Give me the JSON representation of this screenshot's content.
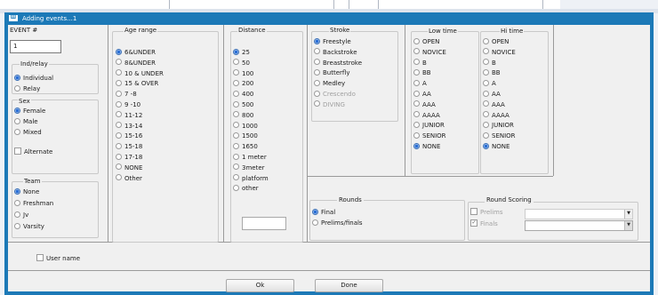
{
  "window": {
    "title": "Adding events...1",
    "icon": "app-icon"
  },
  "event": {
    "label": "EVENT #",
    "value": "1"
  },
  "indrelay": {
    "title": "Ind/relay",
    "options": [
      {
        "label": "Individual",
        "selected": true
      },
      {
        "label": "Relay",
        "selected": false
      }
    ]
  },
  "sex": {
    "title": "Sex",
    "options": [
      {
        "label": "Female",
        "selected": true
      },
      {
        "label": "Male",
        "selected": false
      },
      {
        "label": "Mixed",
        "selected": false
      }
    ],
    "alternate_label": "Alternate",
    "alternate_checked": false
  },
  "team": {
    "title": "Team",
    "options": [
      {
        "label": "None",
        "selected": true
      },
      {
        "label": "Freshman",
        "selected": false
      },
      {
        "label": "Jv",
        "selected": false
      },
      {
        "label": "Varsity",
        "selected": false
      }
    ]
  },
  "age": {
    "title": "Age range",
    "options": [
      {
        "label": "6&UNDER",
        "selected": true
      },
      {
        "label": "8&UNDER",
        "selected": false
      },
      {
        "label": "10 & UNDER",
        "selected": false
      },
      {
        "label": "15 & OVER",
        "selected": false
      },
      {
        "label": "7 -8",
        "selected": false
      },
      {
        "label": "9 -10",
        "selected": false
      },
      {
        "label": "11-12",
        "selected": false
      },
      {
        "label": "13-14",
        "selected": false
      },
      {
        "label": "15-16",
        "selected": false
      },
      {
        "label": "15-18",
        "selected": false
      },
      {
        "label": "17-18",
        "selected": false
      },
      {
        "label": "NONE",
        "selected": false
      },
      {
        "label": "Other",
        "selected": false
      }
    ]
  },
  "distance": {
    "title": "Distance",
    "other_value": "",
    "options": [
      {
        "label": "25",
        "selected": true
      },
      {
        "label": "50",
        "selected": false
      },
      {
        "label": "100",
        "selected": false
      },
      {
        "label": "200",
        "selected": false
      },
      {
        "label": "400",
        "selected": false
      },
      {
        "label": "500",
        "selected": false
      },
      {
        "label": "800",
        "selected": false
      },
      {
        "label": "1000",
        "selected": false
      },
      {
        "label": "1500",
        "selected": false
      },
      {
        "label": "1650",
        "selected": false
      },
      {
        "label": "1 meter",
        "selected": false
      },
      {
        "label": "3meter",
        "selected": false
      },
      {
        "label": "platform",
        "selected": false
      },
      {
        "label": "other",
        "selected": false
      }
    ]
  },
  "stroke": {
    "title": "Stroke",
    "options": [
      {
        "label": "Freestyle",
        "selected": true,
        "disabled": false
      },
      {
        "label": "Backstroke",
        "selected": false,
        "disabled": false
      },
      {
        "label": "Breaststroke",
        "selected": false,
        "disabled": false
      },
      {
        "label": "Butterfly",
        "selected": false,
        "disabled": false
      },
      {
        "label": "Medley",
        "selected": false,
        "disabled": false
      },
      {
        "label": "Crescendo",
        "selected": false,
        "disabled": true
      },
      {
        "label": "DIVING",
        "selected": false,
        "disabled": true
      }
    ]
  },
  "lowtime": {
    "title": "Low time",
    "options": [
      {
        "label": "OPEN",
        "selected": false
      },
      {
        "label": "NOVICE",
        "selected": false
      },
      {
        "label": "B",
        "selected": false
      },
      {
        "label": "BB",
        "selected": false
      },
      {
        "label": "A",
        "selected": false
      },
      {
        "label": "AA",
        "selected": false
      },
      {
        "label": "AAA",
        "selected": false
      },
      {
        "label": "AAAA",
        "selected": false
      },
      {
        "label": "JUNIOR",
        "selected": false
      },
      {
        "label": "SENIOR",
        "selected": false
      },
      {
        "label": "NONE",
        "selected": true
      }
    ]
  },
  "hitime": {
    "title": "Hi time",
    "options": [
      {
        "label": "OPEN",
        "selected": false
      },
      {
        "label": "NOVICE",
        "selected": false
      },
      {
        "label": "B",
        "selected": false
      },
      {
        "label": "BB",
        "selected": false
      },
      {
        "label": "A",
        "selected": false
      },
      {
        "label": "AA",
        "selected": false
      },
      {
        "label": "AAA",
        "selected": false
      },
      {
        "label": "AAAA",
        "selected": false
      },
      {
        "label": "JUNIOR",
        "selected": false
      },
      {
        "label": "SENIOR",
        "selected": false
      },
      {
        "label": "NONE",
        "selected": true
      }
    ]
  },
  "rounds": {
    "title": "Rounds",
    "options": [
      {
        "label": "Final",
        "selected": true
      },
      {
        "label": "Prelims/finals",
        "selected": false
      }
    ]
  },
  "round_scoring": {
    "title": "Round Scoring",
    "prelims": {
      "label": "Prelims",
      "checked": false,
      "disabled": true,
      "value": ""
    },
    "finals": {
      "label": "Finals",
      "checked": true,
      "disabled": true,
      "value": ""
    }
  },
  "username": {
    "label": "User name",
    "checked": false
  },
  "buttons": {
    "ok": "Ok",
    "done": "Done"
  },
  "colors": {
    "accent": "#1c79b7",
    "client_bg": "#f0f0f0",
    "radio_selected": "#2a6fd6"
  }
}
